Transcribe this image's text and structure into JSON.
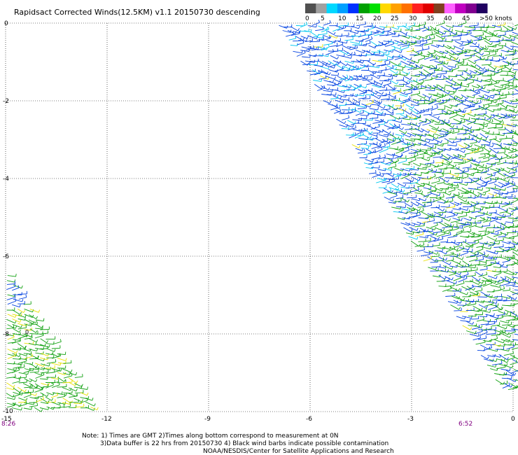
{
  "header": {
    "title": "Rapidsact Corrected Winds(12.5KM) v1.1 20150730 descending"
  },
  "legend": {
    "ticks": [
      "0",
      "5",
      "10",
      "15",
      "20",
      "25",
      "30",
      "35",
      "40",
      "45",
      ">50 knots"
    ],
    "colors": [
      "#505050",
      "#a0a0a0",
      "#00d8ff",
      "#00a0ff",
      "#0030ff",
      "#00a000",
      "#00e000",
      "#ffd800",
      "#ffa000",
      "#ff7000",
      "#ff2020",
      "#e00000",
      "#804020",
      "#ff60ff",
      "#c000c0",
      "#800090",
      "#200060"
    ]
  },
  "map": {
    "y_ticks": [
      "0",
      "-2",
      "-4",
      "-6",
      "-8",
      "-10"
    ],
    "x_ticks": [
      "-15",
      "-12",
      "-9",
      "-6",
      "-3",
      "0"
    ],
    "time_left": "8:26",
    "time_right": "6:52",
    "marker": "0",
    "barb_colors": {
      "low": "#00c8f0",
      "mid": "#0040e0",
      "high": "#10a010",
      "strong": "#e8e000"
    }
  },
  "footer": {
    "line1": "Note: 1) Times are GMT 2)Times along bottom correspond to measurement at 0N",
    "line2": "3)Data buffer is 22 hrs from 20150730 4) Black wind barbs indicate possible contamination",
    "line3": "NOAA/NESDIS/Center for Satellite Applications and Research"
  }
}
